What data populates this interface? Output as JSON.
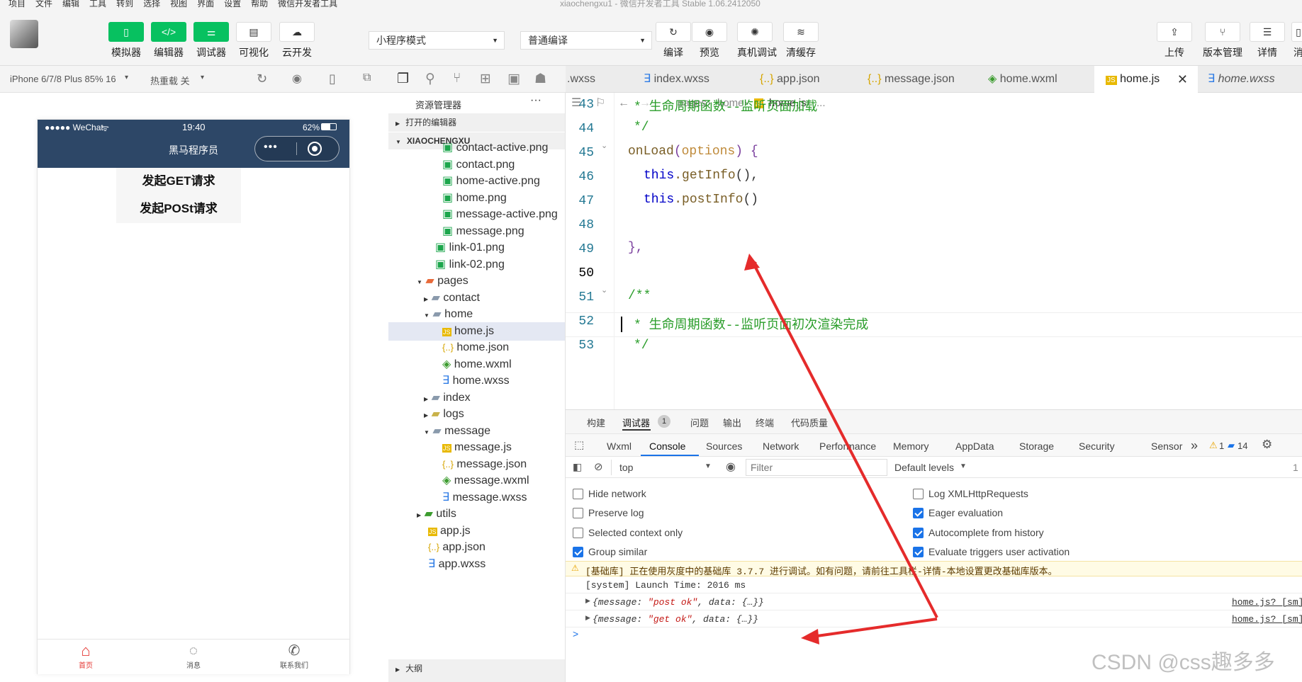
{
  "menubar": {
    "items": [
      "项目",
      "文件",
      "编辑",
      "工具",
      "转到",
      "选择",
      "视图",
      "界面",
      "设置",
      "帮助",
      "微信开发者工具"
    ],
    "window_title": "xiaochengxu1 - 微信开发者工具 Stable 1.06.2412050"
  },
  "toolbar": {
    "simulator": "模拟器",
    "editor": "编辑器",
    "debugger": "调试器",
    "visual": "可视化",
    "cloud": "云开发",
    "mode_select": "小程序模式",
    "compile_select": "普通编译",
    "compile": "编译",
    "preview": "预览",
    "device_debug": "真机调试",
    "clear_cache": "清缓存",
    "upload": "上传",
    "version": "版本管理",
    "details": "详情",
    "more": "消"
  },
  "simbar": {
    "device": "iPhone 6/7/8 Plus 85% 16",
    "hot_reload": "热重载 关"
  },
  "phone": {
    "carrier": "●●●●● WeChat",
    "time": "19:40",
    "battery": "62%",
    "nav_title": "黑马程序员",
    "btn_get": "发起GET请求",
    "btn_post": "发起POSt请求",
    "tabs": [
      {
        "label": "首页",
        "color": "#e53935"
      },
      {
        "label": "消息",
        "color": "#555555"
      },
      {
        "label": "联系我们",
        "color": "#555555"
      }
    ]
  },
  "explorer": {
    "title": "资源管理器",
    "open_editors": "打开的编辑器",
    "project": "XIAOCHENGXU",
    "outline": "大纲",
    "files": [
      "contact-active.png",
      "contact.png",
      "home-active.png",
      "home.png",
      "message-active.png",
      "message.png",
      "link-01.png",
      "link-02.png",
      "pages",
      "contact",
      "home",
      "home.js",
      "home.json",
      "home.wxml",
      "home.wxss",
      "index",
      "logs",
      "message",
      "message.js",
      "message.json",
      "message.wxml",
      "message.wxss",
      "utils",
      "app.js",
      "app.json",
      "app.wxss"
    ]
  },
  "tabs": [
    ".wxss",
    "index.wxss",
    "app.json",
    "message.json",
    "home.wxml",
    "home.js",
    "home.wxss"
  ],
  "breadcrumb": {
    "p1": "pages",
    "p2": "home",
    "p3": "home.js",
    "p4": "..."
  },
  "code": {
    "line_numbers": [
      "43",
      "44",
      "45",
      "46",
      "47",
      "48",
      "49",
      "50",
      "51",
      "52",
      "53"
    ],
    "l43": "* 生命周期函数--监听页面加载",
    "l44": "*/",
    "l45_fn": "onLoad",
    "l45_p1": "(",
    "l45_param": "options",
    "l45_p2": ") {",
    "l46_this": "this",
    "l46_call": ".getInfo",
    "l46_rest": "(),",
    "l47_this": "this",
    "l47_call": ".postInfo",
    "l47_rest": "()",
    "l49": "},",
    "l51": "/**",
    "l52": "* 生命周期函数--监听页面初次渲染完成",
    "l53": "*/"
  },
  "devtools": {
    "top_tabs": [
      "构建",
      "调试器",
      "问题",
      "输出",
      "终端",
      "代码质量"
    ],
    "debugger_badge": "1",
    "panel_tabs": [
      "Wxml",
      "Console",
      "Sources",
      "Network",
      "Performance",
      "Memory",
      "AppData",
      "Storage",
      "Security",
      "Sensor"
    ],
    "more": "»",
    "warn_count": "1",
    "msg_count": "14",
    "context": "top",
    "filter_placeholder": "Filter",
    "levels": "Default levels",
    "right_count": "1",
    "options_left": [
      "Hide network",
      "Preserve log",
      "Selected context only",
      "Group similar"
    ],
    "options_right": [
      "Log XMLHttpRequests",
      "Eager evaluation",
      "Autocomplete from history",
      "Evaluate triggers user activation"
    ],
    "warning": "[基础库] 正在使用灰度中的基础库 3.7.7 进行调试。如有问题，请前往工具栏-详情-本地设置更改基础库版本。",
    "launch": "[system] Launch Time: 2016 ms",
    "log1": {
      "pre": "{message: ",
      "val": "\"post ok\"",
      "post": ", data: {…}}",
      "src": "home.js? [sm]"
    },
    "log2": {
      "pre": "{message: ",
      "val": "\"get ok\"",
      "post": ", data: {…}}",
      "src": "home.js? [sm]"
    },
    "prompt": ">"
  },
  "watermark": "CSDN @css趣多多",
  "colors": {
    "brand_green": "#07c160",
    "nav_bg": "#2d4767",
    "arrow_red": "#e52b2b"
  }
}
